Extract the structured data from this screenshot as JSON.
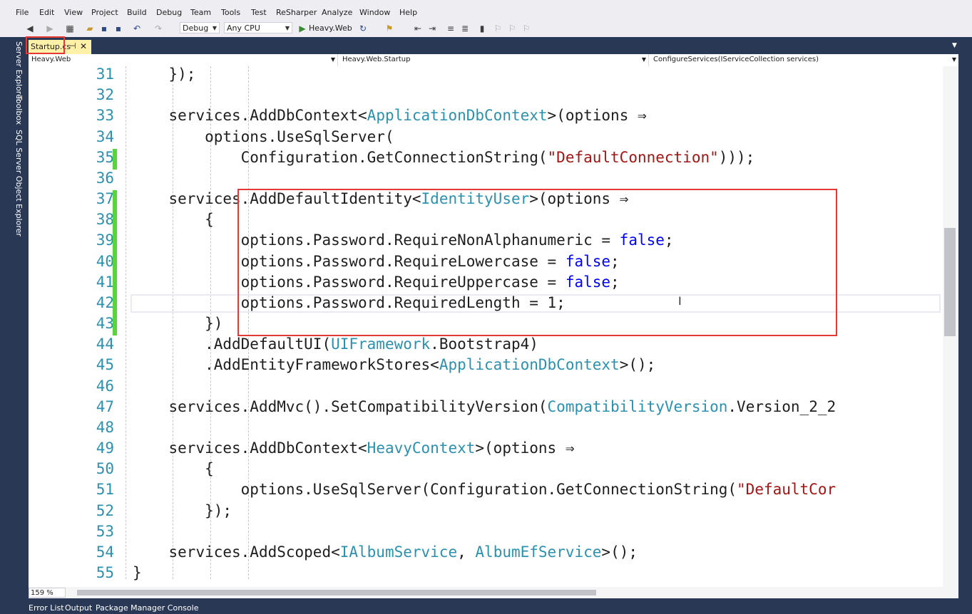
{
  "menu": [
    "File",
    "Edit",
    "View",
    "Project",
    "Build",
    "Debug",
    "Team",
    "Tools",
    "Test",
    "ReSharper",
    "Analyze",
    "Window",
    "Help"
  ],
  "toolbar": {
    "configuration": "Debug",
    "platform": "Any CPU",
    "run_target": "Heavy.Web"
  },
  "side_tabs": [
    "Server Explorer",
    "Toolbox",
    "SQL Server Object Explorer"
  ],
  "tab": {
    "label": "Startup.cs",
    "pin": "⊣",
    "close": "✕"
  },
  "navbar": {
    "project": "Heavy.Web",
    "type": "Heavy.Web.Startup",
    "member": "ConfigureServices(IServiceCollection services)"
  },
  "line_numbers": [
    "31",
    "32",
    "33",
    "34",
    "35",
    "36",
    "37",
    "38",
    "39",
    "40",
    "41",
    "42",
    "43",
    "44",
    "45",
    "46",
    "47",
    "48",
    "49",
    "50",
    "51",
    "52",
    "53",
    "54",
    "55"
  ],
  "code": [
    "            });",
    "",
    "            services.AddDbContext<ApplicationDbContext>(options =>",
    "                options.UseSqlServer(",
    "                    Configuration.GetConnectionString(\"DefaultConnection\")));",
    "",
    "            services.AddDefaultIdentity<IdentityUser>(options =>",
    "                {",
    "                    options.Password.RequireNonAlphanumeric = false;",
    "                    options.Password.RequireLowercase = false;",
    "                    options.Password.RequireUppercase = false;",
    "                    options.Password.RequiredLength = 1;",
    "                })",
    "                .AddDefaultUI(UIFramework.Bootstrap4)",
    "                .AddEntityFrameworkStores<ApplicationDbContext>();",
    "",
    "            services.AddMvc().SetCompatibilityVersion(CompatibilityVersion.Version_2_2",
    "",
    "            services.AddDbContext<HeavyContext>(options =>",
    "                {",
    "                    options.UseSqlServer(Configuration.GetConnectionString(\"DefaultCor",
    "                });",
    "",
    "            services.AddScoped<IAlbumService, AlbumEfService>();",
    "        }"
  ],
  "zoom": "159 %",
  "bottom_tabs": [
    "Error List",
    "Output",
    "Package Manager Console"
  ],
  "colors": {
    "type": "#2b91af",
    "keyword": "#0000ff",
    "string": "#a31515",
    "highlight": "#e53935",
    "change": "#57d63c"
  }
}
